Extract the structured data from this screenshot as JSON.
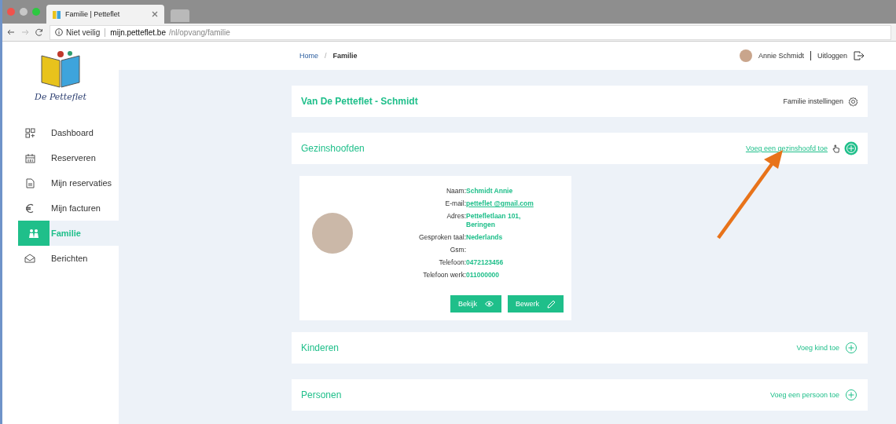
{
  "browser": {
    "tab_title": "Familie | Petteflet",
    "security": "Niet veilig",
    "host": "mijn.petteflet.be",
    "path": "/nl/opvang/familie"
  },
  "sidebar": {
    "logo_text": "De Petteflet",
    "items": [
      {
        "label": "Dashboard",
        "kind": "grid",
        "selected": false
      },
      {
        "label": "Reserveren",
        "kind": "calendar",
        "selected": false
      },
      {
        "label": "Mijn reservaties",
        "kind": "document",
        "selected": false
      },
      {
        "label": "Mijn facturen",
        "kind": "euro",
        "selected": false
      },
      {
        "label": "Familie",
        "kind": "people",
        "selected": true
      },
      {
        "label": "Berichten",
        "kind": "mail",
        "selected": false
      }
    ]
  },
  "breadcrumb": {
    "items": [
      "Home",
      "Familie"
    ],
    "separator": "/"
  },
  "user": {
    "name": "Annie Schmidt",
    "logout": "Uitloggen"
  },
  "family": {
    "title": "Van De Petteflet - Schmidt",
    "settings": "Familie instellingen"
  },
  "sections": [
    {
      "title": "Gezinshoofden",
      "action": "Voeg een gezinshoofd toe",
      "hover": true,
      "members": [
        {
          "fields": [
            {
              "label": "Naam:",
              "value": "Schmidt Annie",
              "kind": "text"
            },
            {
              "label": "E-mail:",
              "value": "petteflet @gmail.com",
              "kind": "link"
            },
            {
              "label": "Adres:",
              "value": "Pettefletlaan 101, Beringen",
              "kind": "text"
            },
            {
              "label": "Gesproken taal:",
              "value": "Nederlands",
              "kind": "text"
            },
            {
              "label": "Gsm:",
              "kind": "text"
            },
            {
              "label": "Telefoon:",
              "value": "0472123456",
              "kind": "text"
            },
            {
              "label": "Telefoon werk:",
              "value": "011000000",
              "kind": "text"
            }
          ],
          "buttons": [
            {
              "label": "Bekijk",
              "kind": "view"
            },
            {
              "label": "Bewerk",
              "kind": "edit"
            }
          ]
        }
      ]
    },
    {
      "title": "Kinderen",
      "action": "Voeg kind toe",
      "hover": false
    },
    {
      "title": "Personen",
      "action": "Voeg een persoon toe",
      "hover": false
    }
  ]
}
